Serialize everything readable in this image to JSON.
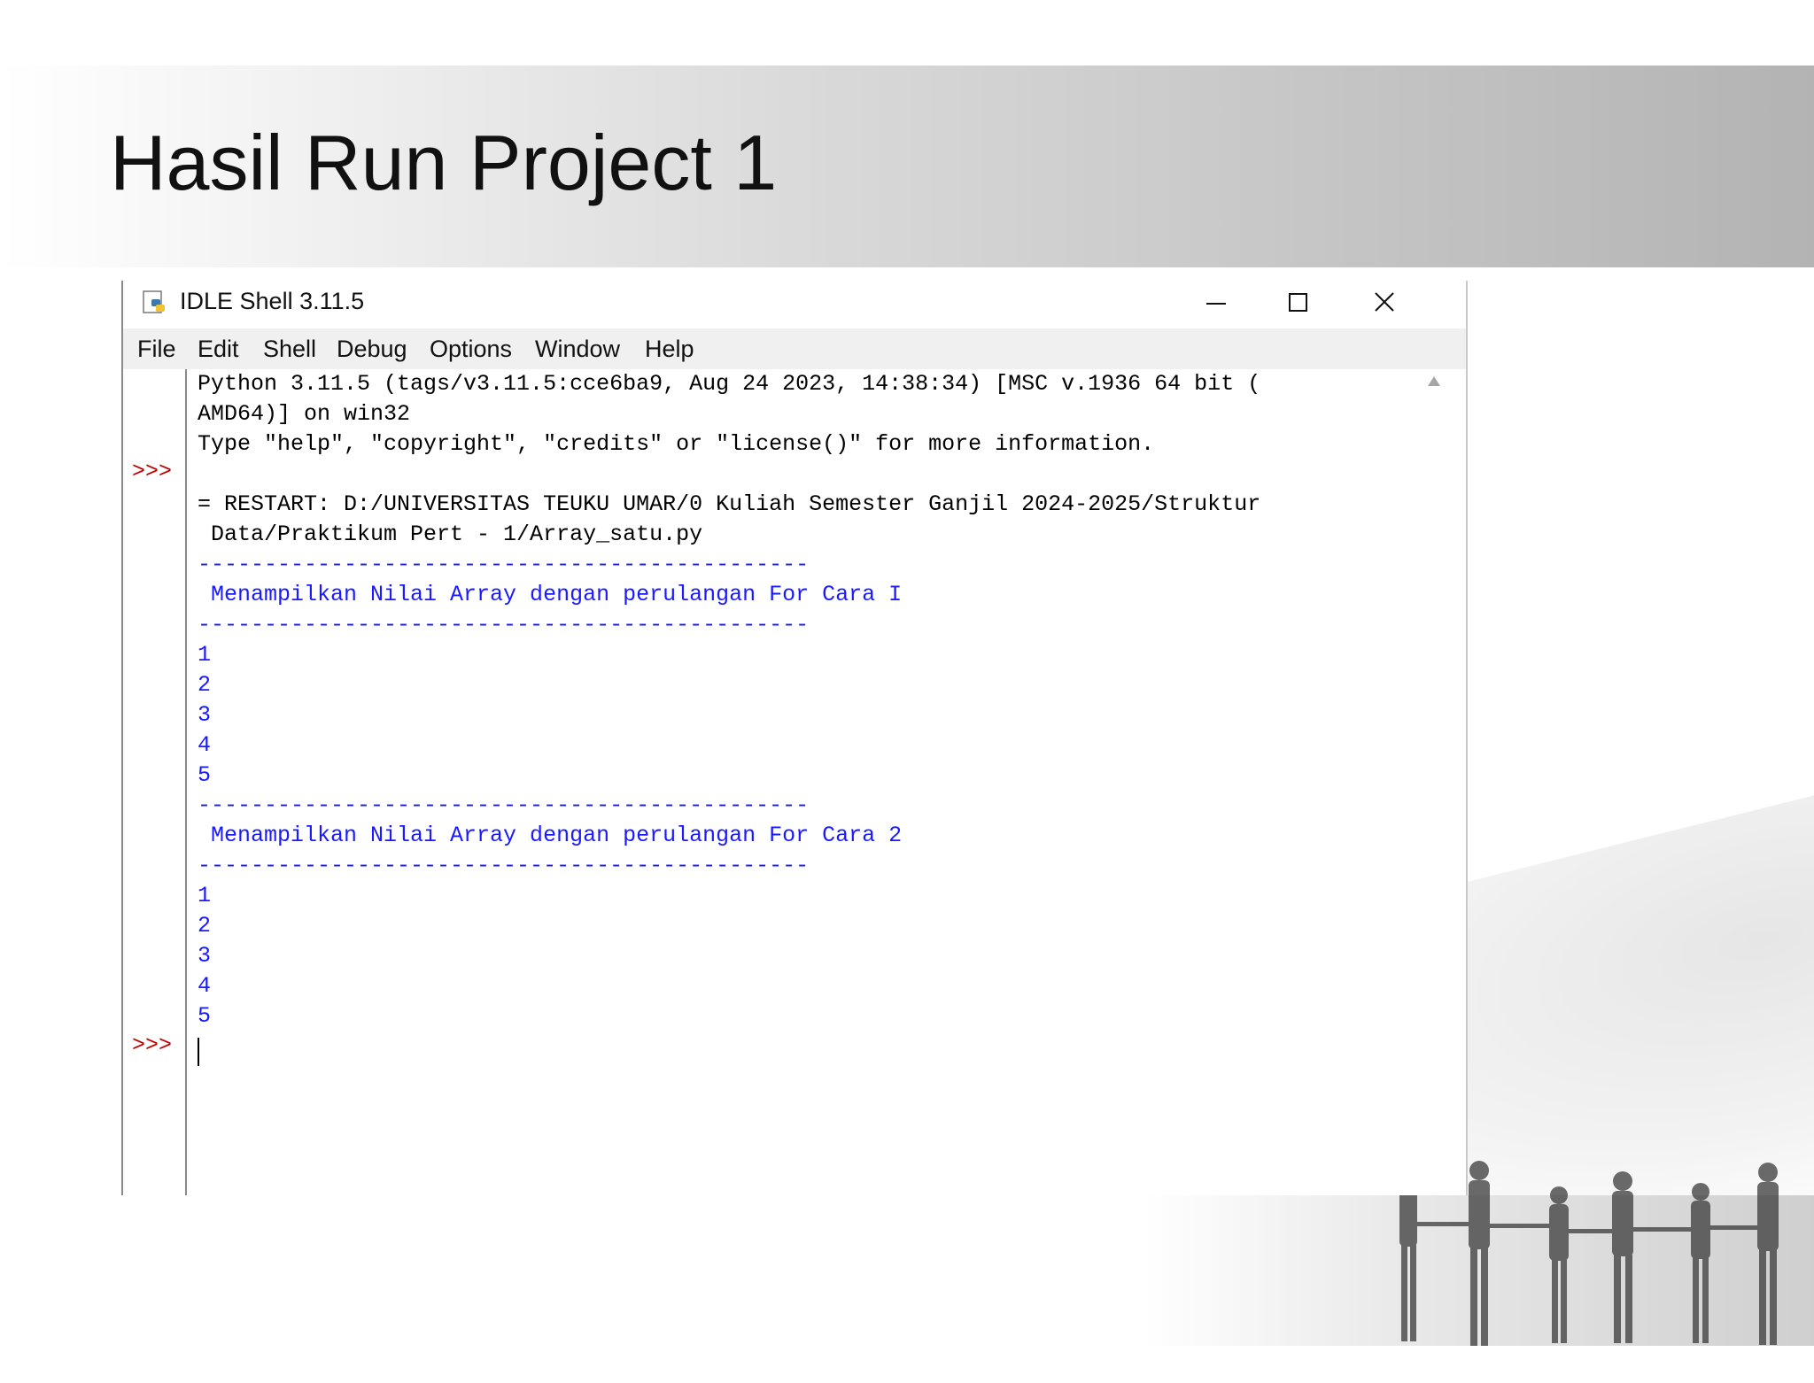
{
  "slide": {
    "title": "Hasil Run Project 1"
  },
  "window": {
    "title": "IDLE Shell 3.11.5",
    "menu": [
      "File",
      "Edit",
      "Shell",
      "Debug",
      "Options",
      "Window",
      "Help"
    ]
  },
  "shell": {
    "prompt": ">>>",
    "lines": [
      "Python 3.11.5 (tags/v3.11.5:cce6ba9, Aug 24 2023, 14:38:34) [MSC v.1936 64 bit (",
      "AMD64)] on win32",
      "Type \"help\", \"copyright\", \"credits\" or \"license()\" for more information.",
      "= RESTART: D:/UNIVERSITAS TEUKU UMAR/0 Kuliah Semester Ganjil 2024-2025/Struktur",
      " Data/Praktikum Pert - 1/Array_satu.py"
    ],
    "separator": "----------------------------------------------",
    "heading1": " Menampilkan Nilai Array dengan perulangan For Cara I",
    "heading2": " Menampilkan Nilai Array dengan perulangan For Cara 2",
    "values1": [
      "1",
      "2",
      "3",
      "4",
      "5"
    ],
    "values2": [
      "1",
      "2",
      "3",
      "4",
      "5"
    ]
  },
  "colors": {
    "output_blue": "#1a1aff",
    "prompt_red": "#c00000"
  }
}
